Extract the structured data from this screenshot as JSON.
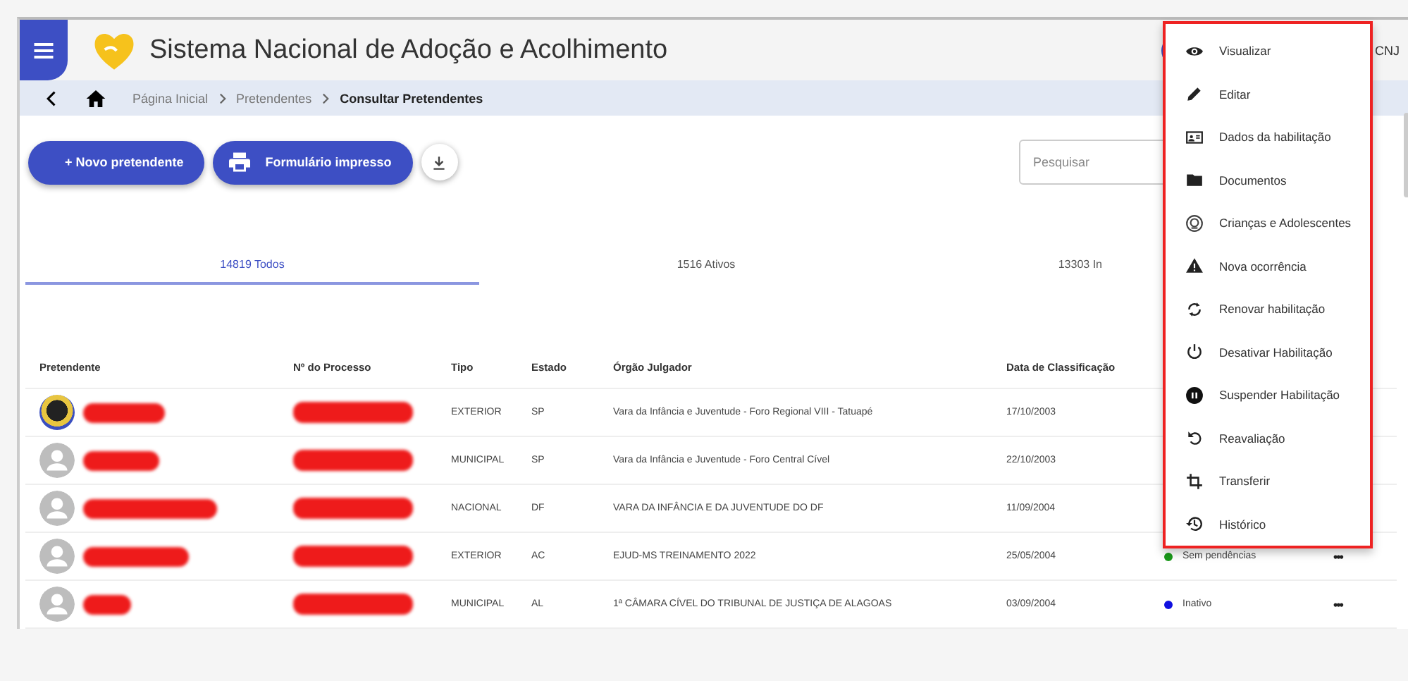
{
  "header": {
    "title": "Sistema Nacional de Adoção e Acolhimento",
    "user_label": "CNJ"
  },
  "breadcrumb": [
    "Página Inicial",
    "Pretendentes",
    "Consultar Pretendentes"
  ],
  "actions": {
    "new_button": "+ Novo pretendente",
    "print_button": "Formulário impresso"
  },
  "search": {
    "placeholder": "Pesquisar"
  },
  "tabs": [
    {
      "label": "14819 Todos",
      "selected": true
    },
    {
      "label": "1516 Ativos",
      "selected": false
    },
    {
      "label": "13303 In",
      "selected": false
    }
  ],
  "table": {
    "columns": [
      "Pretendente",
      "Nº do Processo",
      "Tipo",
      "Estado",
      "Órgão Julgador",
      "Data de Classificação"
    ],
    "rows": [
      {
        "kind": "photo",
        "tipo": "EXTERIOR",
        "estado": "SP",
        "orgao": "Vara da Infância e Juventude - Foro Regional VIII - Tatuapé",
        "data": "17/10/2003"
      },
      {
        "kind": "default",
        "tipo": "MUNICIPAL",
        "estado": "SP",
        "orgao": "Vara da Infância e Juventude - Foro Central Cível",
        "data": "22/10/2003"
      },
      {
        "kind": "default",
        "tipo": "NACIONAL",
        "estado": "DF",
        "orgao": "VARA DA INFÂNCIA E DA JUVENTUDE DO DF",
        "data": "11/09/2004"
      },
      {
        "kind": "default",
        "tipo": "EXTERIOR",
        "estado": "AC",
        "orgao": "EJUD-MS TREINAMENTO 2022",
        "data": "25/05/2004",
        "status": "Sem pendências",
        "color": "#1a9a1a",
        "more": "•••"
      },
      {
        "kind": "default",
        "tipo": "MUNICIPAL",
        "estado": "AL",
        "orgao": "1ª CÂMARA CÍVEL DO TRIBUNAL DE JUSTIÇA DE ALAGOAS",
        "data": "03/09/2004",
        "status": "Inativo",
        "color": "#1010e0",
        "more": "•••"
      }
    ]
  },
  "context_menu": [
    {
      "kind": "eye",
      "label": "Visualizar"
    },
    {
      "kind": "pencil",
      "label": "Editar"
    },
    {
      "kind": "card",
      "label": "Dados da habilitação"
    },
    {
      "kind": "folder",
      "label": "Documentos"
    },
    {
      "kind": "face",
      "label": "Crianças e Adolescentes"
    },
    {
      "kind": "warning",
      "label": "Nova ocorrência"
    },
    {
      "kind": "renew",
      "label": "Renovar habilitação"
    },
    {
      "kind": "power",
      "label": "Desativar Habilitação"
    },
    {
      "kind": "pause",
      "label": "Suspender Habilitação"
    },
    {
      "kind": "undo",
      "label": "Reavaliação"
    },
    {
      "kind": "crop",
      "label": "Transferir"
    },
    {
      "kind": "history",
      "label": "Histórico"
    }
  ]
}
